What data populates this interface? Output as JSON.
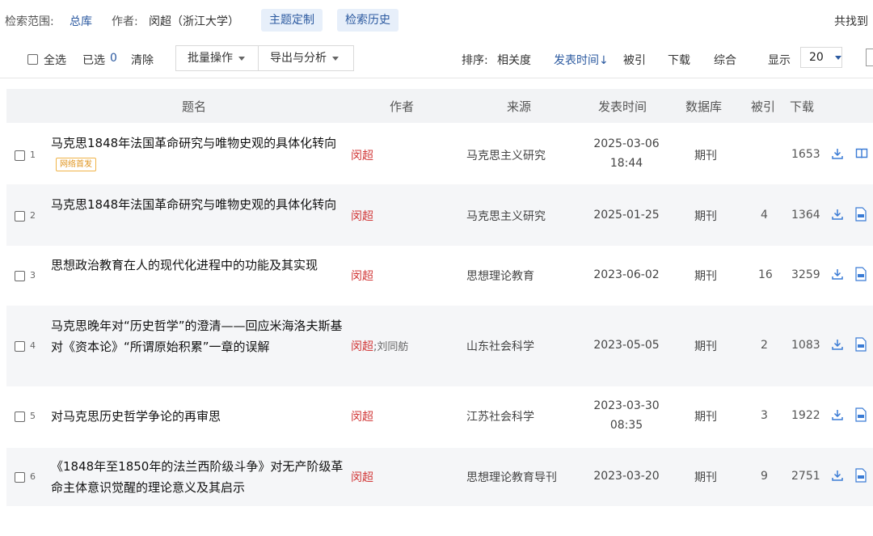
{
  "search_bar": {
    "scope_label": "检索范围:",
    "scope_value": "总库",
    "author_label": "作者:",
    "author_value": "闵超（浙江大学）",
    "topic_button": "主题定制",
    "history_button": "检索历史",
    "found_label": "共找到"
  },
  "toolbar": {
    "select_all": "全选",
    "selected_label": "已选",
    "selected_count": "0",
    "clear": "清除",
    "batch_ops": "批量操作",
    "export_analyze": "导出与分析",
    "sort_label": "排序:",
    "sort_options": [
      "相关度",
      "发表时间↓",
      "被引",
      "下载",
      "综合"
    ],
    "active_sort": "发表时间↓",
    "display_label": "显示",
    "page_size": "20"
  },
  "table": {
    "columns": [
      "题名",
      "作者",
      "来源",
      "发表时间",
      "数据库",
      "被引",
      "下载"
    ],
    "rows": [
      {
        "num": "1",
        "title": "马克思1848年法国革命研究与唯物史观的具体化转向",
        "badge": "网络首发",
        "author": "闵超",
        "coauthor": "",
        "source": "马克思主义研究",
        "date": "2025-03-06",
        "time": "18:44",
        "db": "期刊",
        "cited": "",
        "downloads": "1653"
      },
      {
        "num": "2",
        "title": "马克思1848年法国革命研究与唯物史观的具体化转向",
        "badge": "",
        "author": "闵超",
        "coauthor": "",
        "source": "马克思主义研究",
        "date": "2025-01-25",
        "time": "",
        "db": "期刊",
        "cited": "4",
        "downloads": "1364"
      },
      {
        "num": "3",
        "title": "思想政治教育在人的现代化进程中的功能及其实现",
        "badge": "",
        "author": "闵超",
        "coauthor": "",
        "source": "思想理论教育",
        "date": "2023-06-02",
        "time": "",
        "db": "期刊",
        "cited": "16",
        "downloads": "3259"
      },
      {
        "num": "4",
        "title": "马克思晚年对“历史哲学”的澄清——回应米海洛夫斯基对《资本论》“所谓原始积累”一章的误解",
        "badge": "",
        "author": "闵超",
        "coauthor": ";刘同舫",
        "source": "山东社会科学",
        "date": "2023-05-05",
        "time": "",
        "db": "期刊",
        "cited": "2",
        "downloads": "1083"
      },
      {
        "num": "5",
        "title": "对马克思历史哲学争论的再审思",
        "badge": "",
        "author": "闵超",
        "coauthor": "",
        "source": "江苏社会科学",
        "date": "2023-03-30",
        "time": "08:35",
        "db": "期刊",
        "cited": "3",
        "downloads": "1922"
      },
      {
        "num": "6",
        "title": "《1848年至1850年的法兰西阶级斗争》对无产阶级革命主体意识觉醒的理论意义及其启示",
        "badge": "",
        "author": "闵超",
        "coauthor": "",
        "source": "思想理论教育导刊",
        "date": "2023-03-20",
        "time": "",
        "db": "期刊",
        "cited": "9",
        "downloads": "2751"
      }
    ]
  },
  "colors": {
    "accent": "#2c5aa0",
    "author": "#d23a3a",
    "badge": "#e09520",
    "header_bg": "#f2f3f5",
    "pill_bg": "#e7effa"
  }
}
